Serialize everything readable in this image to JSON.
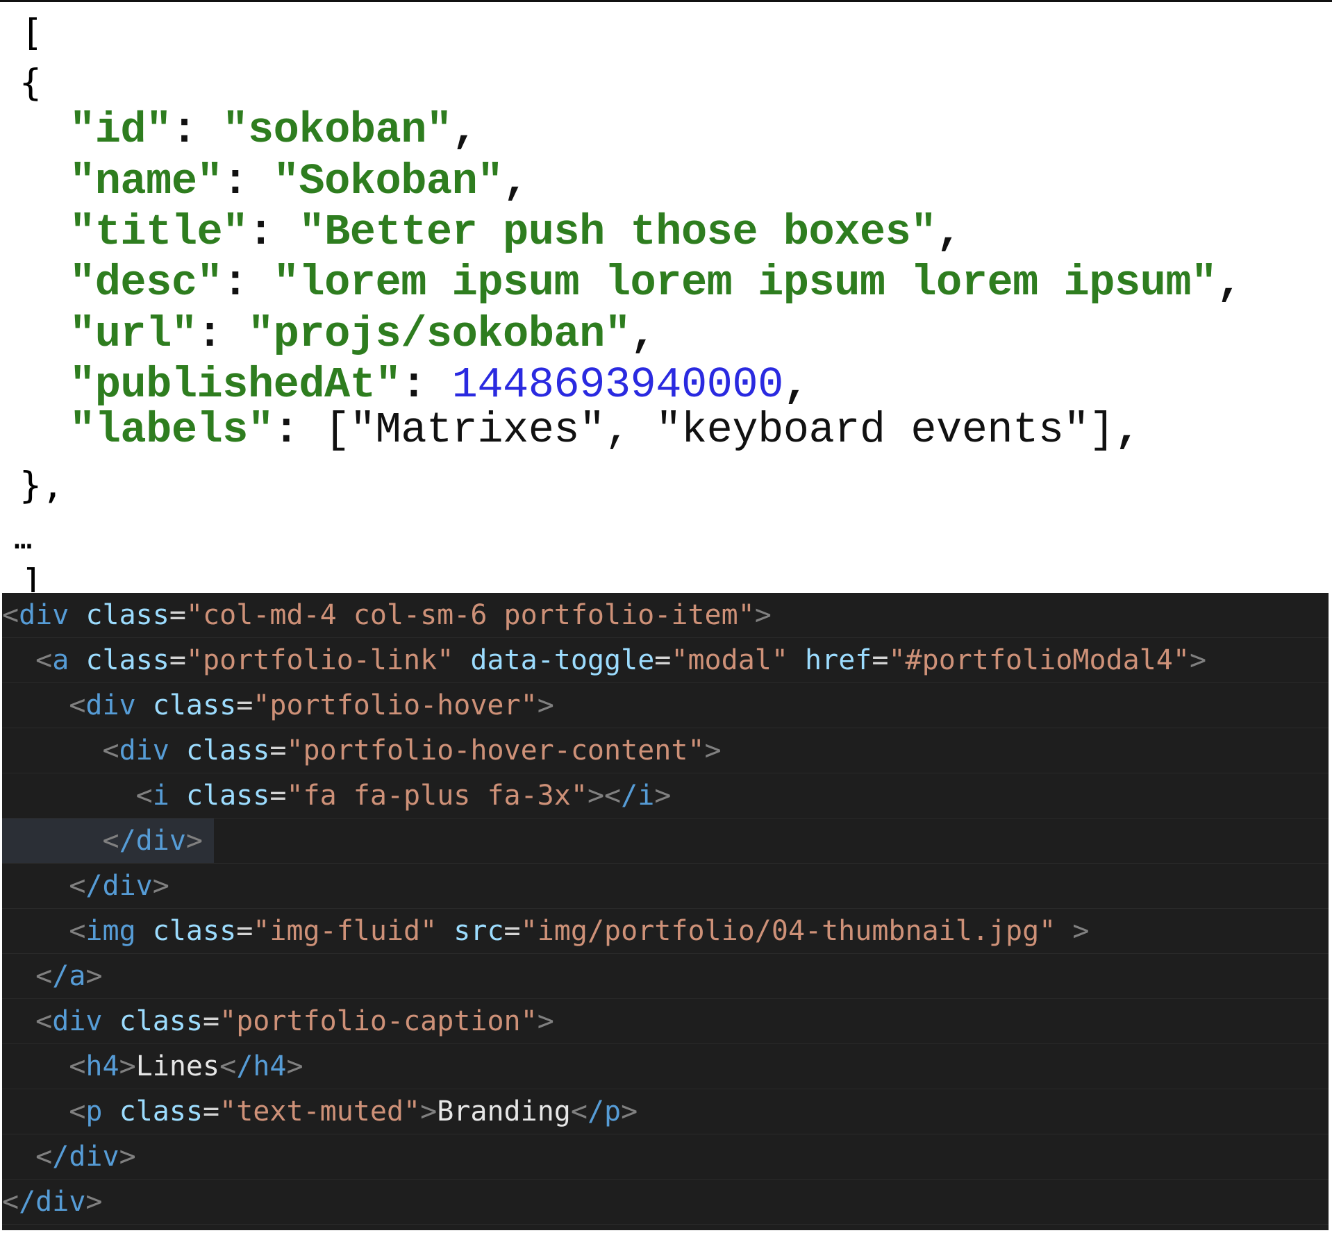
{
  "json_snippet": {
    "open_bracket": "[",
    "open_brace": "{",
    "id_key": "\"id\"",
    "id_value": "\"sokoban\"",
    "name_key": "\"name\"",
    "name_value": "\"Sokoban\"",
    "title_key": "\"title\"",
    "title_value": "\"Better push those boxes\"",
    "desc_key": "\"desc\"",
    "desc_value": "\"lorem ipsum lorem ipsum lorem ipsum\"",
    "url_key": "\"url\"",
    "url_value": "\"projs/sokoban\"",
    "published_key": "\"publishedAt\"",
    "published_value": "1448693940000",
    "labels_key": "\"labels\"",
    "labels_value": "[\"Matrixes\", \"keyboard events\"]",
    "close_brace": "},",
    "ellipsis": "…",
    "close_bracket": "]"
  },
  "html_snippet": {
    "l1": {
      "tag": "div",
      "attr": "class",
      "val": "\"col-md-4 col-sm-6 portfolio-item\""
    },
    "l2": {
      "tag": "a",
      "attr1": "class",
      "val1": "\"portfolio-link\"",
      "attr2": "data-toggle",
      "val2": "\"modal\"",
      "attr3": "href",
      "val3": "\"#portfolioModal4\""
    },
    "l3": {
      "tag": "div",
      "attr": "class",
      "val": "\"portfolio-hover\""
    },
    "l4": {
      "tag": "div",
      "attr": "class",
      "val": "\"portfolio-hover-content\""
    },
    "l5": {
      "tag": "i",
      "attr": "class",
      "val": "\"fa fa-plus fa-3x\"",
      "close": "/i"
    },
    "l6": {
      "close": "/div"
    },
    "l7": {
      "close": "/div"
    },
    "l8": {
      "tag": "img",
      "attr1": "class",
      "val1": "\"img-fluid\"",
      "attr2": "src",
      "val2": "\"img/portfolio/04-thumbnail.jpg\""
    },
    "l9": {
      "close": "/a"
    },
    "l10": {
      "tag": "div",
      "attr": "class",
      "val": "\"portfolio-caption\""
    },
    "l11": {
      "tag": "h4",
      "text": "Lines",
      "close": "/h4"
    },
    "l12": {
      "tag": "p",
      "attr": "class",
      "val": "\"text-muted\"",
      "text": "Branding",
      "close": "/p"
    },
    "l13": {
      "close": "/div"
    },
    "l14": {
      "close": "/div"
    }
  }
}
